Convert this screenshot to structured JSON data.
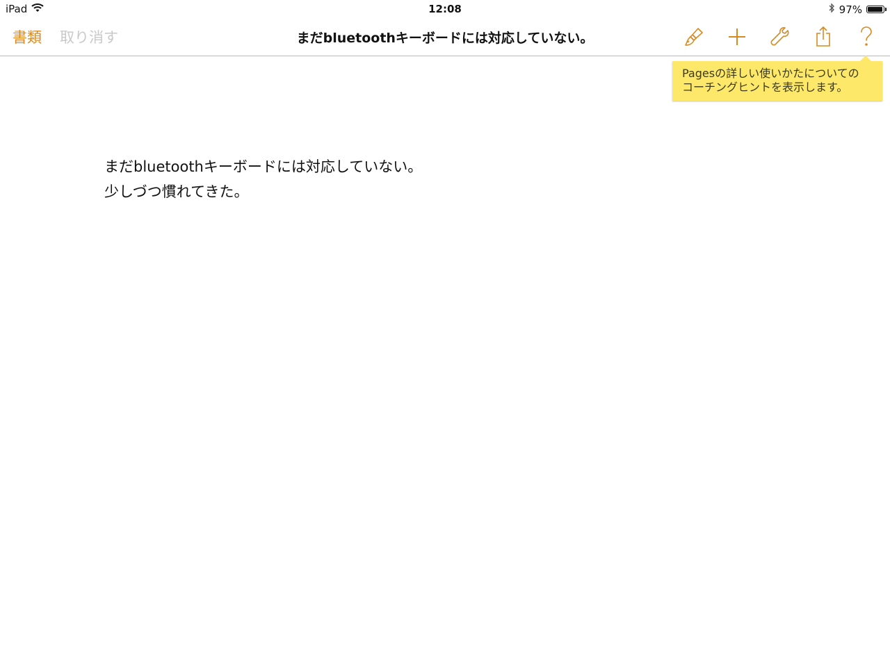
{
  "status_bar": {
    "device": "iPad",
    "time": "12:08",
    "battery_percent": "97%",
    "battery_level": 0.97
  },
  "toolbar": {
    "documents_label": "書類",
    "undo_label": "取り消す",
    "title": "まだbluetoothキーボードには対応していない。",
    "accent_color": "#d98a1f",
    "icons": [
      "paintbrush-icon",
      "plus-icon",
      "wrench-icon",
      "share-icon",
      "help-icon"
    ]
  },
  "tooltip": {
    "line1": "Pagesの詳しい使いかたについての",
    "line2": "コーチングヒントを表示します。",
    "background": "#fde869"
  },
  "document": {
    "lines": [
      "まだbluetoothキーボードには対応していない。",
      "少しづつ慣れてきた。"
    ]
  }
}
